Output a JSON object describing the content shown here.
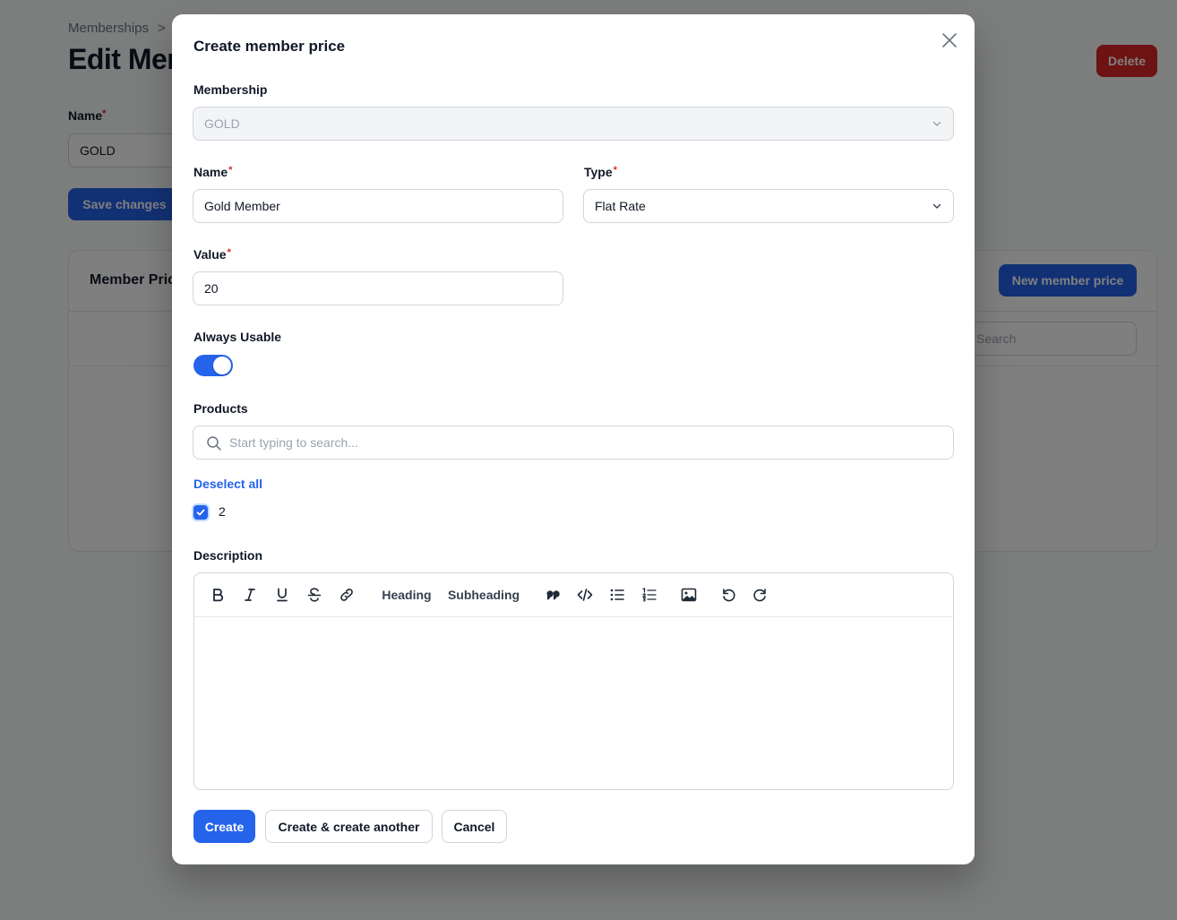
{
  "background": {
    "breadcrumb": {
      "item": "Memberships",
      "separator": ">"
    },
    "page_title": "Edit Men",
    "delete_label": "Delete",
    "name_label": "Name",
    "name_value": "GOLD",
    "save_label": "Save changes",
    "card_title": "Member Pric",
    "new_button_label": "New member price",
    "search_placeholder": "Search"
  },
  "modal": {
    "title": "Create member price",
    "membership": {
      "label": "Membership",
      "value": "GOLD"
    },
    "name": {
      "label": "Name",
      "value": "Gold Member"
    },
    "type": {
      "label": "Type",
      "value": "Flat Rate"
    },
    "value": {
      "label": "Value",
      "value": "20"
    },
    "always_usable": {
      "label": "Always Usable",
      "checked": true
    },
    "products": {
      "label": "Products",
      "placeholder": "Start typing to search...",
      "deselect_label": "Deselect all",
      "items": [
        {
          "label": "2",
          "checked": true
        }
      ]
    },
    "description": {
      "label": "Description",
      "toolbar": {
        "heading": "Heading",
        "subheading": "Subheading",
        "icons": [
          "bold-icon",
          "italic-icon",
          "underline-icon",
          "strikethrough-icon",
          "link-icon",
          "quote-icon",
          "code-icon",
          "bullet-list-icon",
          "ordered-list-icon",
          "image-icon",
          "undo-icon",
          "redo-icon"
        ]
      }
    },
    "required_marker": "*",
    "buttons": {
      "create": "Create",
      "create_another": "Create & create another",
      "cancel": "Cancel"
    }
  },
  "colors": {
    "primary": "#2563eb",
    "danger": "#dc2626",
    "overlay": "rgba(0,0,0,0.5)"
  }
}
